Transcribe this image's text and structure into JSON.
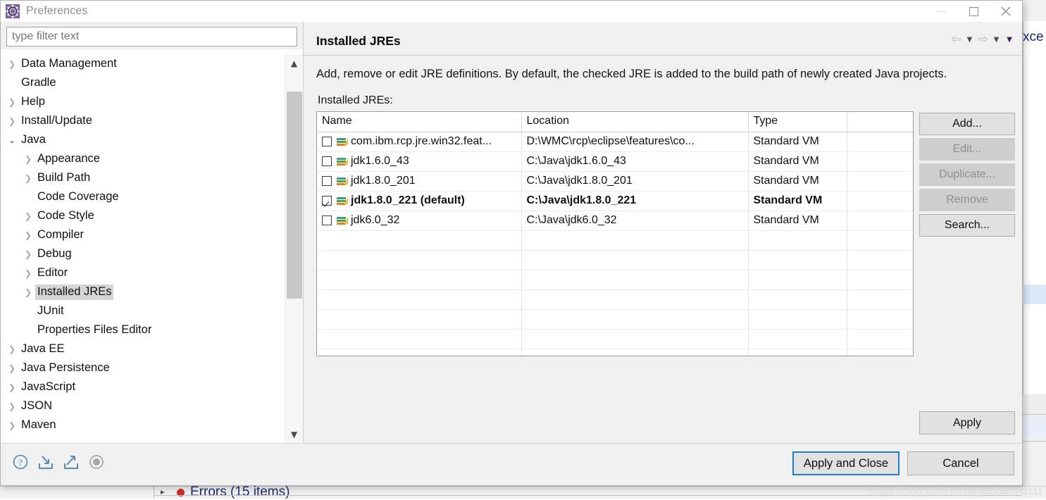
{
  "window": {
    "title": "Preferences",
    "app_icon": "gear-icon",
    "controls": {
      "minimize": "minimize-icon",
      "maximize": "maximize-icon",
      "close": "close-icon"
    }
  },
  "filter": {
    "placeholder": "type filter text",
    "value": ""
  },
  "tree": {
    "items": [
      {
        "label": "Data Management",
        "depth": 0,
        "state": "collapsed",
        "selected": false
      },
      {
        "label": "Gradle",
        "depth": 0,
        "state": "leaf",
        "selected": false
      },
      {
        "label": "Help",
        "depth": 0,
        "state": "collapsed",
        "selected": false
      },
      {
        "label": "Install/Update",
        "depth": 0,
        "state": "collapsed",
        "selected": false
      },
      {
        "label": "Java",
        "depth": 0,
        "state": "expanded",
        "selected": false
      },
      {
        "label": "Appearance",
        "depth": 1,
        "state": "collapsed",
        "selected": false
      },
      {
        "label": "Build Path",
        "depth": 1,
        "state": "collapsed",
        "selected": false
      },
      {
        "label": "Code Coverage",
        "depth": 1,
        "state": "leaf",
        "selected": false
      },
      {
        "label": "Code Style",
        "depth": 1,
        "state": "collapsed",
        "selected": false
      },
      {
        "label": "Compiler",
        "depth": 1,
        "state": "collapsed",
        "selected": false
      },
      {
        "label": "Debug",
        "depth": 1,
        "state": "collapsed",
        "selected": false
      },
      {
        "label": "Editor",
        "depth": 1,
        "state": "collapsed",
        "selected": false
      },
      {
        "label": "Installed JREs",
        "depth": 1,
        "state": "collapsed",
        "selected": true
      },
      {
        "label": "JUnit",
        "depth": 1,
        "state": "leaf",
        "selected": false
      },
      {
        "label": "Properties Files Editor",
        "depth": 1,
        "state": "leaf",
        "selected": false
      },
      {
        "label": "Java EE",
        "depth": 0,
        "state": "collapsed",
        "selected": false
      },
      {
        "label": "Java Persistence",
        "depth": 0,
        "state": "collapsed",
        "selected": false
      },
      {
        "label": "JavaScript",
        "depth": 0,
        "state": "collapsed",
        "selected": false
      },
      {
        "label": "JSON",
        "depth": 0,
        "state": "collapsed",
        "selected": false
      },
      {
        "label": "Maven",
        "depth": 0,
        "state": "collapsed",
        "selected": false
      }
    ],
    "scroll_up_glyph": "chevron-up-icon",
    "scroll_down_glyph": "chevron-down-icon"
  },
  "page": {
    "title": "Installed JREs",
    "description": "Add, remove or edit JRE definitions. By default, the checked JRE is added to the build path of newly created Java projects.",
    "list_label": "Installed JREs:",
    "nav": {
      "back": "arrow-left-icon",
      "back_menu": "chevron-down-icon",
      "forward": "arrow-right-icon",
      "forward_menu": "chevron-down-icon",
      "overflow_menu": "chevron-down-icon"
    }
  },
  "table": {
    "columns": [
      "Name",
      "Location",
      "Type",
      ""
    ],
    "rows": [
      {
        "checked": false,
        "name": "com.ibm.rcp.jre.win32.feat...",
        "location": "D:\\WMC\\rcp\\eclipse\\features\\co...",
        "type": "Standard VM",
        "extra": "",
        "is_default": false
      },
      {
        "checked": false,
        "name": "jdk1.6.0_43",
        "location": "C:\\Java\\jdk1.6.0_43",
        "type": "Standard VM",
        "extra": "",
        "is_default": false
      },
      {
        "checked": false,
        "name": "jdk1.8.0_201",
        "location": "C:\\Java\\jdk1.8.0_201",
        "type": "Standard VM",
        "extra": "",
        "is_default": false
      },
      {
        "checked": true,
        "name": "jdk1.8.0_221 (default)",
        "location": "C:\\Java\\jdk1.8.0_221",
        "type": "Standard VM",
        "extra": "",
        "is_default": true
      },
      {
        "checked": false,
        "name": "jdk6.0_32",
        "location": "C:\\Java\\jdk6.0_32",
        "type": "Standard VM",
        "extra": "",
        "is_default": false
      }
    ],
    "empty_row_count": 7
  },
  "side_buttons": [
    {
      "label": "Add...",
      "enabled": true
    },
    {
      "label": "Edit...",
      "enabled": false
    },
    {
      "label": "Duplicate...",
      "enabled": false
    },
    {
      "label": "Remove",
      "enabled": false
    },
    {
      "label": "Search...",
      "enabled": true
    }
  ],
  "apply_button": {
    "label": "Apply"
  },
  "footer": {
    "icons": [
      {
        "name": "help-icon"
      },
      {
        "name": "import-icon"
      },
      {
        "name": "export-icon"
      },
      {
        "name": "restore-defaults-icon"
      }
    ],
    "apply_and_close": "Apply and Close",
    "cancel": "Cancel",
    "focused_button": "Apply and Close",
    "focus_color": "#1f7fd4"
  },
  "background": {
    "edge_text": "xce",
    "problems_text": "Errors (15 items)",
    "problems_arrow": "▸"
  },
  "watermark": "https://blog.csdn.net/qigaidawang111",
  "colors": {
    "dialog_bg": "#f0f0f0",
    "pane_bg": "#ffffff",
    "selection": "#d5d5d5",
    "focus_blue": "#1f7fd4",
    "button_face": "#e1e1e1",
    "button_disabled": "#cecece",
    "error_red": "#cf2a2a",
    "ide_text_blue": "#1b2c6b"
  }
}
